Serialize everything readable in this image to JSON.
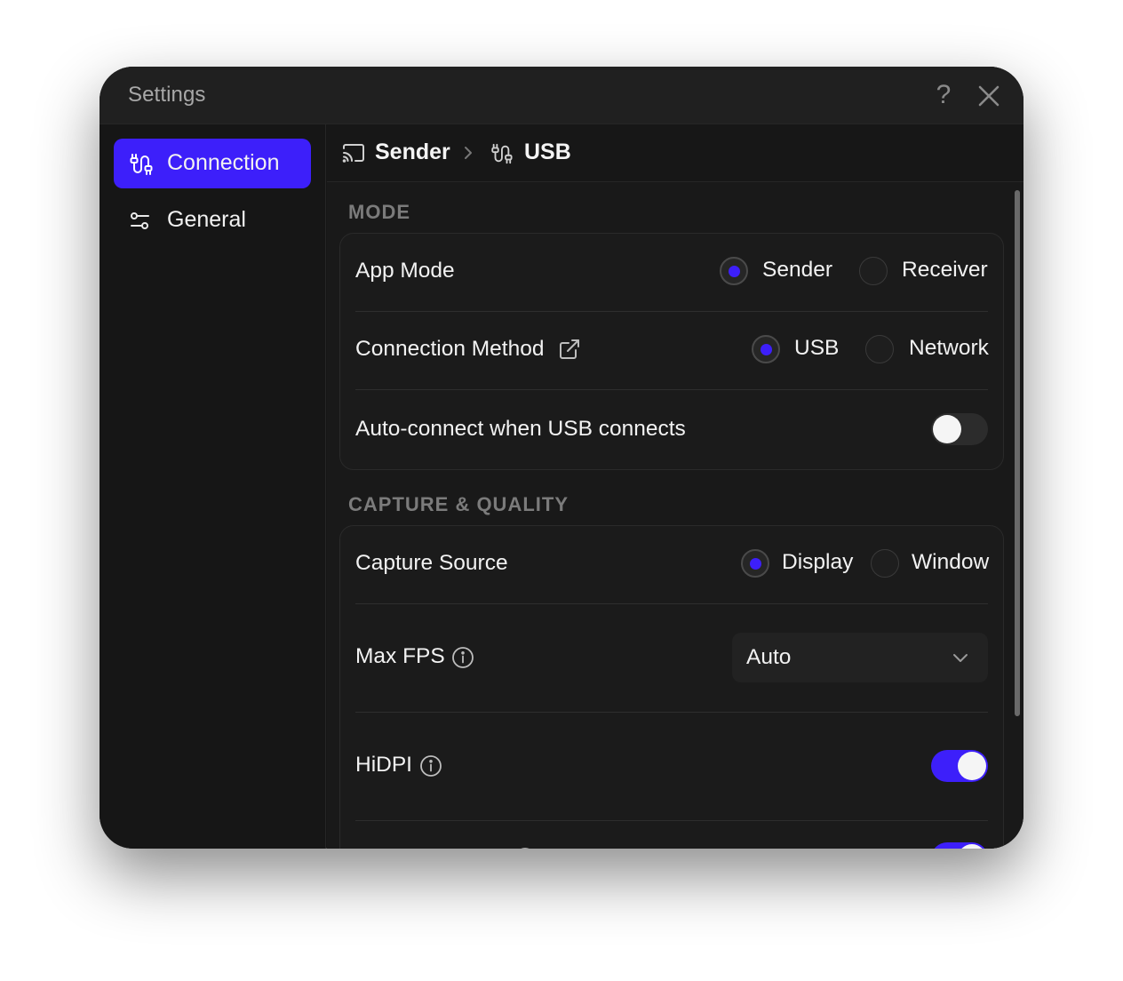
{
  "window": {
    "title": "Settings",
    "help_icon": "help-icon",
    "help_symbol": "?",
    "close_icon": "close-icon"
  },
  "sidebar": {
    "items": [
      {
        "label": "Connection",
        "icon": "cable-icon",
        "active": true
      },
      {
        "label": "General",
        "icon": "sliders-icon",
        "active": false
      }
    ]
  },
  "breadcrumb": {
    "items": [
      {
        "label": "Sender",
        "icon": "cast-icon"
      },
      {
        "label": "USB",
        "icon": "cable-icon"
      }
    ],
    "separator_icon": "chevron-right-icon"
  },
  "sections": {
    "mode": {
      "title": "MODE",
      "app_mode": {
        "label": "App Mode",
        "options": [
          "Sender",
          "Receiver"
        ],
        "selected": "Sender"
      },
      "connection_method": {
        "label": "Connection Method",
        "link_icon": "external-link-icon",
        "options": [
          "USB",
          "Network"
        ],
        "selected": "USB"
      },
      "auto_connect": {
        "label": "Auto-connect when USB connects",
        "enabled": false
      }
    },
    "capture": {
      "title": "CAPTURE & QUALITY",
      "capture_source": {
        "label": "Capture Source",
        "options": [
          "Display",
          "Window"
        ],
        "selected": "Display"
      },
      "max_fps": {
        "label": "Max FPS",
        "info_icon": "info-icon",
        "value": "Auto"
      },
      "hidpi": {
        "label": "HiDPI",
        "info_icon": "info-icon",
        "enabled": true
      },
      "next_row": {
        "enabled": true
      }
    }
  },
  "colors": {
    "accent": "#3d1ffa",
    "background": "#161616",
    "card": "#1b1b1b",
    "text": "#f2f2f2",
    "muted": "#7b7b7b"
  }
}
